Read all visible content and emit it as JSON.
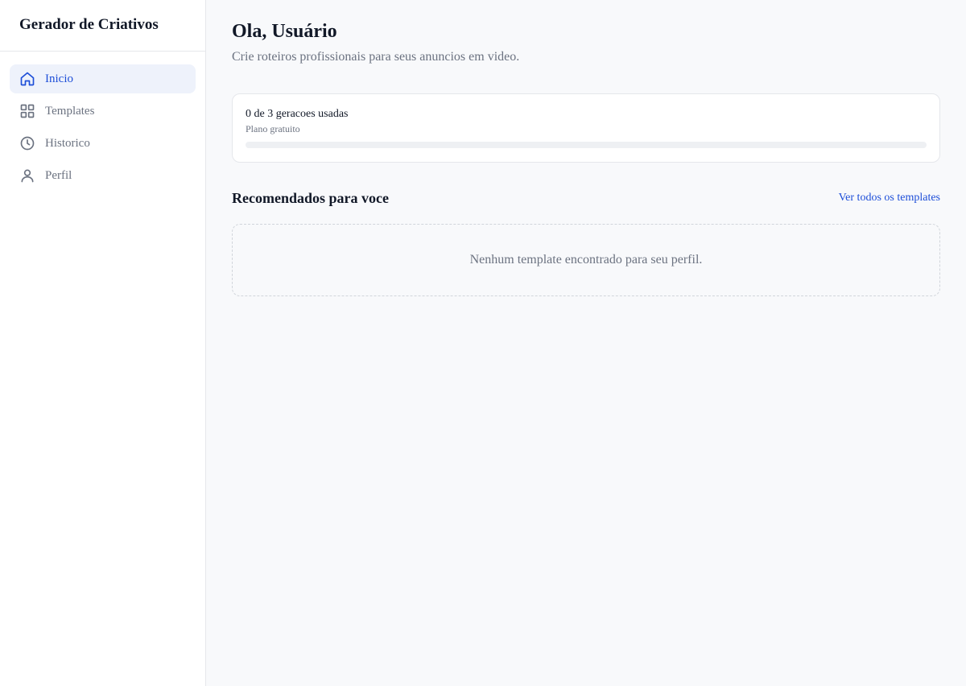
{
  "app": {
    "title": "Gerador de Criativos"
  },
  "sidebar": {
    "items": [
      {
        "label": "Inicio",
        "icon": "home-icon",
        "active": true
      },
      {
        "label": "Templates",
        "icon": "grid-icon",
        "active": false
      },
      {
        "label": "Historico",
        "icon": "clock-icon",
        "active": false
      },
      {
        "label": "Perfil",
        "icon": "user-icon",
        "active": false
      }
    ]
  },
  "header": {
    "greeting": "Ola, Usuário",
    "subtitle": "Crie roteiros profissionais para seus anuncios em video."
  },
  "usage": {
    "text": "0 de 3 geracoes usadas",
    "plan": "Plano gratuito",
    "used": 0,
    "total": 3
  },
  "recommended": {
    "title": "Recomendados para voce",
    "link": "Ver todos os templates",
    "empty_message": "Nenhum template encontrado para seu perfil."
  },
  "colors": {
    "accent": "#1d4ed8",
    "active_bg": "#eef2fb",
    "background": "#f8f9fb"
  }
}
